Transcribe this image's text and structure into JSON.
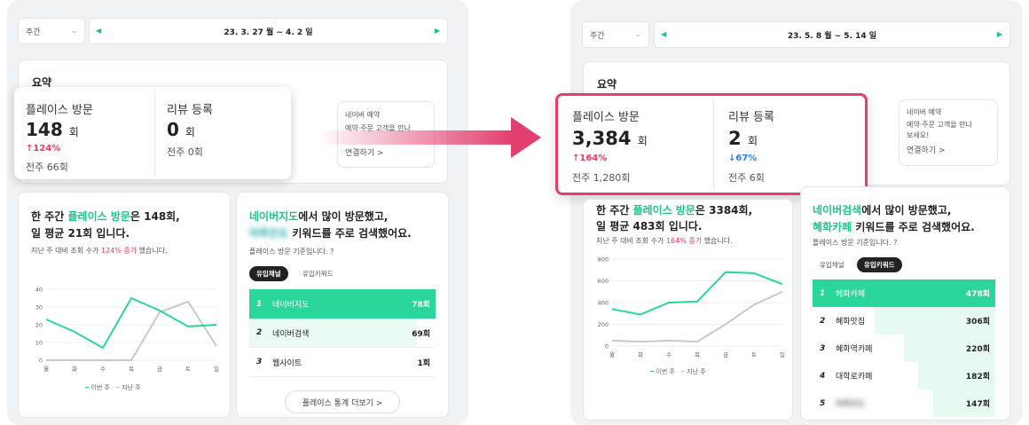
{
  "left": {
    "period_select": "주간",
    "date_range": "23. 3. 27 월 ~ 4. 2 일",
    "summary_title": "요약",
    "visits": {
      "label": "플레이스 방문",
      "value": "148",
      "unit": "회",
      "change": "↑124%",
      "prev": "전주 66회"
    },
    "reviews": {
      "label": "리뷰 등록",
      "value": "0",
      "unit": "회",
      "prev": "전주 0회"
    },
    "naver_booking": {
      "label": "네이버 예약",
      "desc": "예약·주문 고객을 만나",
      "link": "연결하기 >"
    },
    "weekly_text": {
      "pre": "한 주간 ",
      "hl": "플레이스 방문",
      "post1": "은 148회,",
      "line2": "일 평균 21회 입니다.",
      "sub_pre": "지난 주 대비 조회 수가 ",
      "sub_hl": "124% 증가",
      "sub_post": " 했습니다."
    },
    "channel_text": {
      "hl": "네이버지도",
      "post1": "에서 많이 방문했고,",
      "blur": "마루끈도",
      "post2": " 키워드를 주로 검색했어요."
    },
    "basis": "플레이스 방문 기준입니다. ?",
    "tabs": [
      "유입채널",
      "유입키워드"
    ],
    "rows": [
      {
        "rank": "1",
        "name": "네이버지도",
        "count": "78회"
      },
      {
        "rank": "2",
        "name": "네이버검색",
        "count": "69회"
      },
      {
        "rank": "3",
        "name": "웹사이트",
        "count": "1회"
      }
    ],
    "more_button": "플레이스 통계 더보기 >",
    "legend": {
      "this": "이번 주",
      "last": "지난 주"
    }
  },
  "right": {
    "period_select": "주간",
    "date_range": "23. 5. 8 월 ~ 5. 14 일",
    "summary_title": "요약",
    "visits": {
      "label": "플레이스 방문",
      "value": "3,384",
      "unit": "회",
      "change": "↑164%",
      "prev": "전주 1,280회"
    },
    "reviews": {
      "label": "리뷰 등록",
      "value": "2",
      "unit": "회",
      "change": "↓67%",
      "prev": "전주 6회"
    },
    "naver_booking": {
      "label": "네이버 예약",
      "desc1": "예약·주문 고객을 만나",
      "desc2": "보세요!",
      "link": "연결하기 >"
    },
    "weekly_text": {
      "pre": "한 주간 ",
      "hl": "플레이스 방문",
      "post1": "은 3384회,",
      "line2": "일 평균 483회 입니다.",
      "sub_pre": "지난 주 대비 조회 수가 ",
      "sub_hl": "164% 증가",
      "sub_post": " 했습니다."
    },
    "channel_text": {
      "hl1": "네이버검색",
      "post1": "에서 많이 방문했고,",
      "hl2": "혜화카페",
      "post2": " 키워드를 주로 검색했어요."
    },
    "basis": "플레이스 방문 기준입니다. ?",
    "tabs": [
      "유입채널",
      "유입키워드"
    ],
    "rows": [
      {
        "rank": "1",
        "name": "혜화카페",
        "count": "478회"
      },
      {
        "rank": "2",
        "name": "혜화맛집",
        "count": "306회"
      },
      {
        "rank": "3",
        "name": "혜화역카페",
        "count": "220회"
      },
      {
        "rank": "4",
        "name": "대학로카페",
        "count": "182회"
      },
      {
        "rank": "5",
        "name": "마루끈도",
        "count": "147회"
      }
    ],
    "legend": {
      "this": "이번 주",
      "last": "지난 주"
    }
  },
  "chart_data": [
    {
      "type": "line",
      "categories": [
        "월",
        "화",
        "수",
        "목",
        "금",
        "토",
        "일"
      ],
      "ylim": [
        0,
        40
      ],
      "yticks": [
        "0",
        "10",
        "20",
        "30",
        "40"
      ],
      "series": [
        {
          "name": "이번 주",
          "color": "#2bd69b",
          "values": [
            23,
            16,
            7,
            35,
            28,
            19,
            20
          ]
        },
        {
          "name": "지난 주",
          "color": "#c9c9cc",
          "values": [
            0,
            0,
            0,
            0,
            27,
            33,
            8
          ]
        }
      ]
    },
    {
      "type": "line",
      "categories": [
        "월",
        "화",
        "수",
        "목",
        "금",
        "토",
        "일"
      ],
      "ylim": [
        0,
        800
      ],
      "yticks": [
        "0",
        "200",
        "400",
        "600",
        "800"
      ],
      "series": [
        {
          "name": "이번 주",
          "color": "#2bd69b",
          "values": [
            340,
            290,
            400,
            410,
            680,
            670,
            570
          ]
        },
        {
          "name": "지난 주",
          "color": "#c9c9cc",
          "values": [
            50,
            40,
            50,
            40,
            200,
            380,
            500
          ]
        }
      ]
    }
  ]
}
